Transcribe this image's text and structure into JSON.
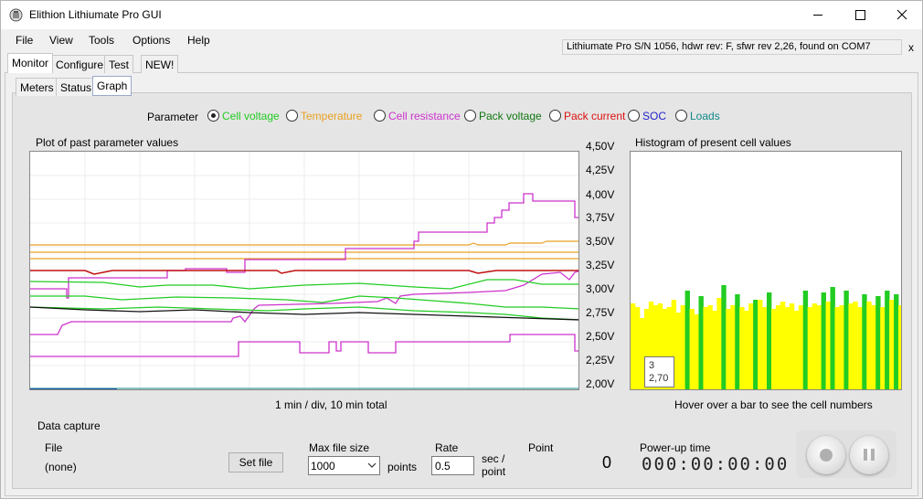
{
  "window": {
    "title": "Elithion Lithiumate Pro GUI"
  },
  "menu": [
    "File",
    "View",
    "Tools",
    "Options",
    "Help"
  ],
  "status": {
    "text": "Lithiumate Pro S/N 1056, hdwr rev: F, sfwr rev 2,26, found on COM7",
    "close": "x"
  },
  "tabs": [
    "Monitor",
    "Configure",
    "Test",
    "NEW!"
  ],
  "subtabs": [
    "Meters",
    "Status",
    "Graph"
  ],
  "parameter": {
    "label": "Parameter",
    "options": [
      {
        "label": "Cell voltage",
        "color": "#22cc22",
        "selected": true
      },
      {
        "label": "Temperature",
        "color": "#e8a020",
        "selected": false
      },
      {
        "label": "Cell resistance",
        "color": "#cc33cc",
        "selected": false
      },
      {
        "label": "Pack voltage",
        "color": "#117711",
        "selected": false
      },
      {
        "label": "Pack current",
        "color": "#dd1111",
        "selected": false
      },
      {
        "label": "SOC",
        "color": "#2222cc",
        "selected": false
      },
      {
        "label": "Loads",
        "color": "#118888",
        "selected": false
      }
    ]
  },
  "plot": {
    "title": "Plot of past parameter values",
    "caption": "1 min / div, 10 min total"
  },
  "histogram": {
    "title": "Histogram of present cell values",
    "caption": "Hover over a bar to see the cell numbers",
    "tooltip": {
      "cell": "3",
      "value": "2,70"
    }
  },
  "yaxis": {
    "ticks": [
      "4,50V",
      "4,25V",
      "4,00V",
      "3,75V",
      "3,50V",
      "3,25V",
      "3,00V",
      "2,75V",
      "2,50V",
      "2,25V",
      "2,00V"
    ]
  },
  "capture": {
    "section": "Data capture",
    "file_label": "File",
    "file_value": "(none)",
    "set_file": "Set file",
    "max_label": "Max file size",
    "max_value": "1000",
    "points": "points",
    "rate_label": "Rate",
    "rate_value": "0.5",
    "rate_unit_1": "sec /",
    "rate_unit_2": "point",
    "point_label": "Point",
    "point_value": "0",
    "powerup_label": "Power-up time",
    "powerup_value": "000:00:00:00"
  }
}
